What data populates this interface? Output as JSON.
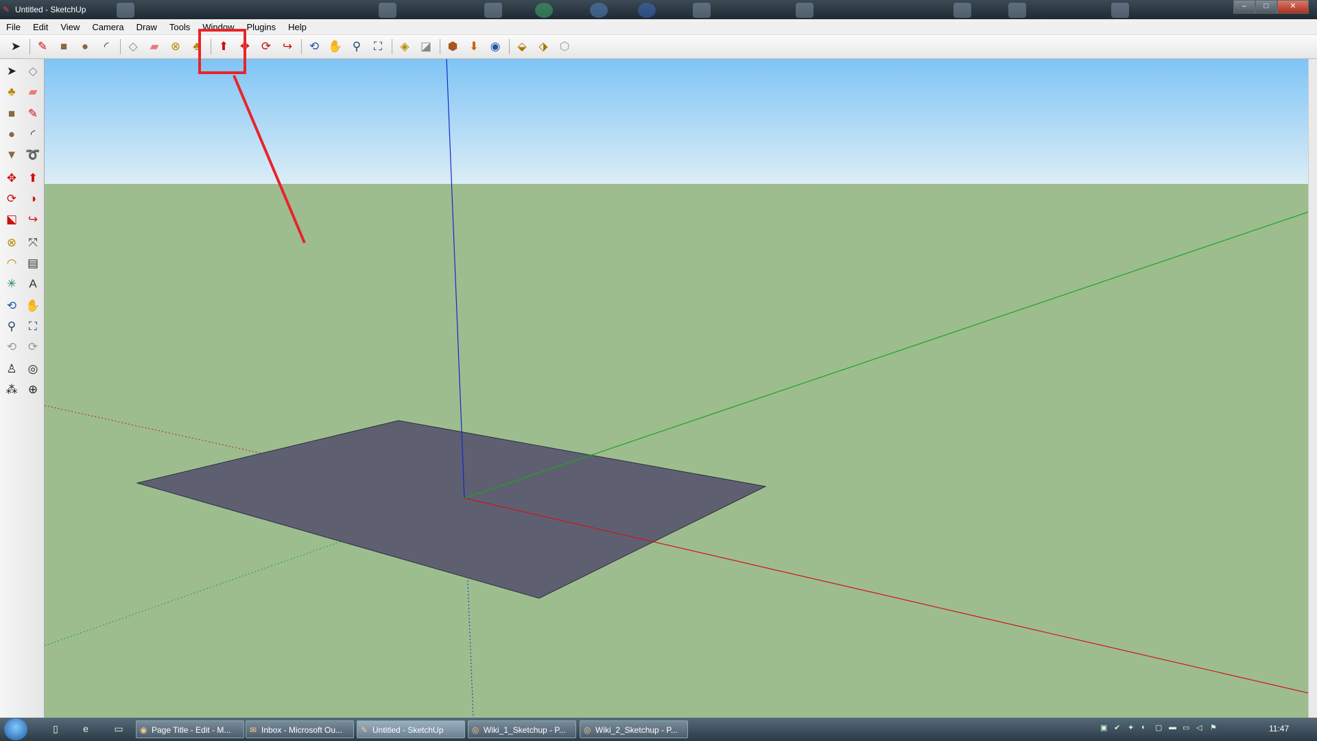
{
  "window": {
    "title": "Untitled - SketchUp",
    "min": "–",
    "max": "□",
    "close": "✕"
  },
  "menu": [
    "File",
    "Edit",
    "View",
    "Camera",
    "Draw",
    "Tools",
    "Window",
    "Plugins",
    "Help"
  ],
  "toolbar": [
    {
      "name": "select-tool-icon",
      "glyph": "➤",
      "color": "#222"
    },
    {
      "name": "pencil-tool-icon",
      "glyph": "✎",
      "color": "#c11"
    },
    {
      "name": "rectangle-tool-icon",
      "glyph": "■",
      "color": "#8a6a40"
    },
    {
      "name": "circle-tool-icon",
      "glyph": "●",
      "color": "#8a6a40"
    },
    {
      "name": "arc-tool-icon",
      "glyph": "◜",
      "color": "#333"
    },
    {
      "name": "make-component-icon",
      "glyph": "◇",
      "color": "#888"
    },
    {
      "name": "eraser-tool-icon",
      "glyph": "▰",
      "color": "#e77"
    },
    {
      "name": "tape-measure-icon",
      "glyph": "⊗",
      "color": "#b80"
    },
    {
      "name": "paint-bucket-icon",
      "glyph": "♣",
      "color": "#b80"
    },
    {
      "name": "push-pull-tool-icon",
      "glyph": "⬆",
      "color": "#c11"
    },
    {
      "name": "move-tool-icon",
      "glyph": "✥",
      "color": "#c11"
    },
    {
      "name": "rotate-tool-icon",
      "glyph": "⟳",
      "color": "#c11"
    },
    {
      "name": "follow-me-tool-icon",
      "glyph": "↪",
      "color": "#c11"
    },
    {
      "name": "orbit-tool-icon",
      "glyph": "⟲",
      "color": "#25a"
    },
    {
      "name": "pan-tool-icon",
      "glyph": "✋",
      "color": "#444"
    },
    {
      "name": "zoom-tool-icon",
      "glyph": "⚲",
      "color": "#246"
    },
    {
      "name": "zoom-extents-icon",
      "glyph": "⛶",
      "color": "#246"
    },
    {
      "name": "add-location-icon",
      "glyph": "◈",
      "color": "#b80"
    },
    {
      "name": "toggle-terrain-icon",
      "glyph": "◪",
      "color": "#888"
    },
    {
      "name": "photo-textures-icon",
      "glyph": "⬢",
      "color": "#a52"
    },
    {
      "name": "get-models-icon",
      "glyph": "⬇",
      "color": "#c60"
    },
    {
      "name": "share-model-icon",
      "glyph": "◉",
      "color": "#25a"
    },
    {
      "name": "components-3d-icon",
      "glyph": "⬙",
      "color": "#a70"
    },
    {
      "name": "share-component-icon",
      "glyph": "⬗",
      "color": "#a70"
    },
    {
      "name": "extension-warehouse-icon",
      "glyph": "⬡",
      "color": "#999"
    }
  ],
  "lefttools": [
    {
      "name": "select-tool-icon",
      "glyph": "➤",
      "color": "#222"
    },
    {
      "name": "make-component-icon",
      "glyph": "◇",
      "color": "#888"
    },
    {
      "name": "paint-bucket-icon",
      "glyph": "♣",
      "color": "#b80"
    },
    {
      "name": "eraser-tool-icon",
      "glyph": "▰",
      "color": "#e77"
    },
    {
      "name": "rectangle-tool-icon",
      "glyph": "■",
      "color": "#8a6a40"
    },
    {
      "name": "line-tool-icon",
      "glyph": "✎",
      "color": "#c11"
    },
    {
      "name": "circle-tool-icon",
      "glyph": "●",
      "color": "#8a6a40"
    },
    {
      "name": "arc-tool-icon",
      "glyph": "◜",
      "color": "#333"
    },
    {
      "name": "polygon-tool-icon",
      "glyph": "▼",
      "color": "#8a6a40"
    },
    {
      "name": "freehand-tool-icon",
      "glyph": "➰",
      "color": "#333"
    },
    {
      "name": "move-tool-icon",
      "glyph": "✥",
      "color": "#c11"
    },
    {
      "name": "push-pull-tool-icon",
      "glyph": "⬆",
      "color": "#c11"
    },
    {
      "name": "rotate-tool-icon",
      "glyph": "⟳",
      "color": "#c11"
    },
    {
      "name": "follow-me-tool-icon",
      "glyph": "◑",
      "color": "#c11"
    },
    {
      "name": "scale-tool-icon",
      "glyph": "⬕",
      "color": "#c11"
    },
    {
      "name": "offset-tool-icon",
      "glyph": "↪",
      "color": "#c11"
    },
    {
      "name": "tape-measure-icon",
      "glyph": "⊗",
      "color": "#b80"
    },
    {
      "name": "dimension-tool-icon",
      "glyph": "⤧",
      "color": "#333"
    },
    {
      "name": "protractor-tool-icon",
      "glyph": "◠",
      "color": "#b80"
    },
    {
      "name": "text-tool-icon",
      "glyph": "▤",
      "color": "#333"
    },
    {
      "name": "axes-tool-icon",
      "glyph": "✳",
      "color": "#285"
    },
    {
      "name": "3d-text-tool-icon",
      "glyph": "A",
      "color": "#333"
    },
    {
      "name": "orbit-tool-icon",
      "glyph": "⟲",
      "color": "#25a"
    },
    {
      "name": "pan-tool-icon",
      "glyph": "✋",
      "color": "#444"
    },
    {
      "name": "zoom-tool-icon",
      "glyph": "⚲",
      "color": "#246"
    },
    {
      "name": "zoom-window-icon",
      "glyph": "⛶",
      "color": "#246"
    },
    {
      "name": "previous-view-icon",
      "glyph": "⟲",
      "color": "#999"
    },
    {
      "name": "next-view-icon",
      "glyph": "⟳",
      "color": "#999"
    },
    {
      "name": "position-camera-icon",
      "glyph": "♙",
      "color": "#222"
    },
    {
      "name": "look-around-icon",
      "glyph": "◎",
      "color": "#222"
    },
    {
      "name": "walk-tool-icon",
      "glyph": "⁂",
      "color": "#222"
    },
    {
      "name": "section-plane-icon",
      "glyph": "⊕",
      "color": "#222"
    }
  ],
  "taskbar": [
    {
      "label": "Page Title - Edit - M...",
      "icon": "◉"
    },
    {
      "label": "Inbox - Microsoft Ou...",
      "icon": "✉"
    },
    {
      "label": "Untitled - SketchUp",
      "icon": "✎",
      "active": true
    },
    {
      "label": "Wiki_1_Sketchup - P...",
      "icon": "◎"
    },
    {
      "label": "Wiki_2_Sketchup - P...",
      "icon": "◎"
    }
  ],
  "clock": "11:47",
  "colors": {
    "sky_top": "#7fc4f5",
    "sky_bottom": "#dcedf6",
    "ground": "#9dbd8f",
    "plane": "#5e6072",
    "axis_red": "#d21414",
    "axis_green": "#1fa31f",
    "axis_blue": "#1626c8",
    "highlight": "#e8242b"
  }
}
